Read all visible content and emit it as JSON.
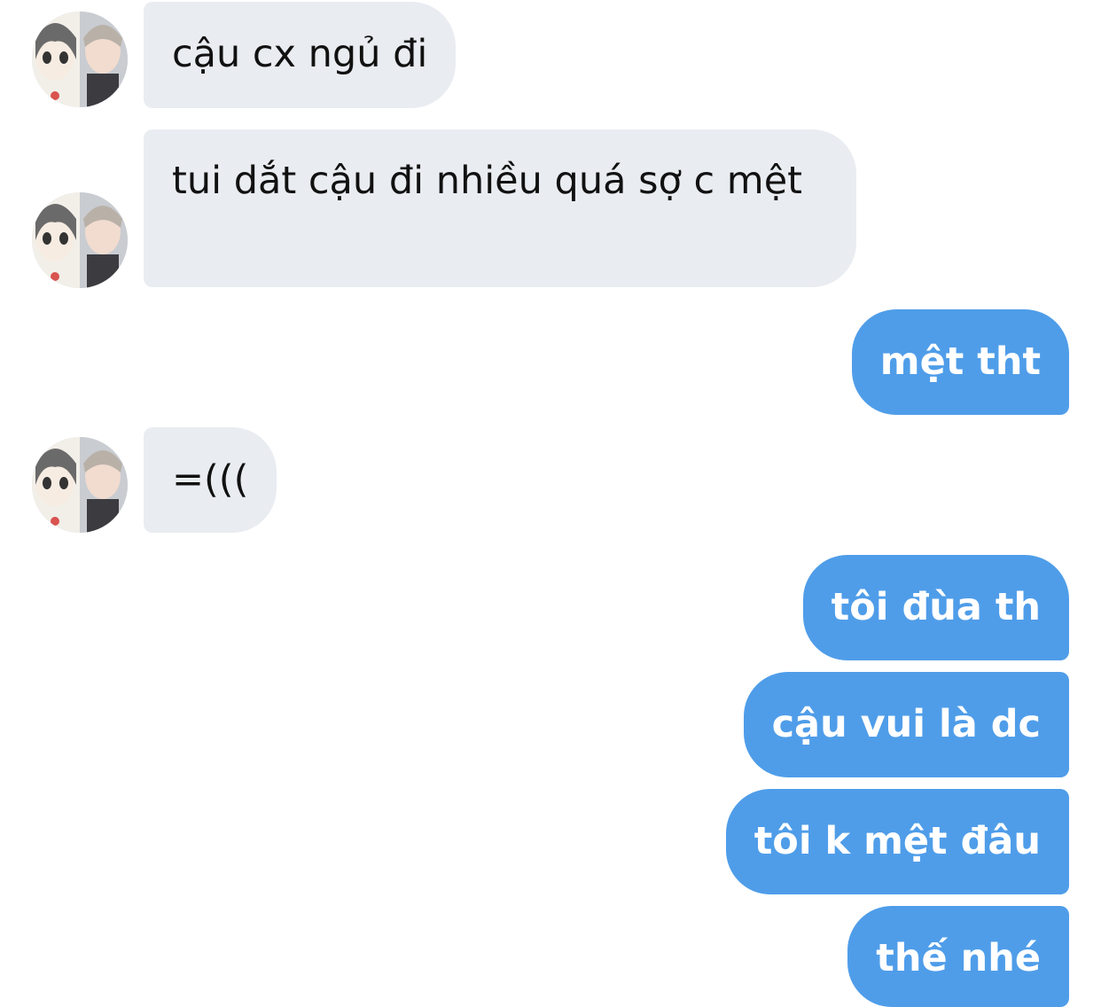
{
  "messages": [
    {
      "from": "other",
      "text": "cậu cx ngủ đi"
    },
    {
      "from": "other",
      "text": "tui dắt cậu đi nhiều quá sợ c mệt"
    },
    {
      "from": "me",
      "text": "mệt tht"
    },
    {
      "from": "other",
      "text": "=((("
    },
    {
      "from": "me",
      "text": "tôi đùa th"
    },
    {
      "from": "me",
      "text": "cậu vui là dc"
    },
    {
      "from": "me",
      "text": "tôi k mệt đâu"
    },
    {
      "from": "me",
      "text": "thế nhé"
    }
  ],
  "colors": {
    "incoming_bubble": "#e9ecf1",
    "outgoing_bubble": "#4f9de9",
    "incoming_text": "#111111",
    "outgoing_text": "#ffffff"
  },
  "icons": {
    "avatar": "profile-photo"
  }
}
